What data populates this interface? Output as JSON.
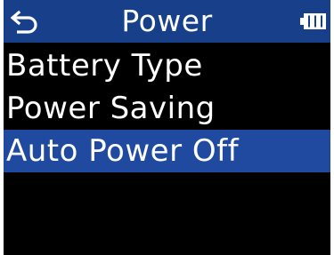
{
  "header": {
    "title": "Power",
    "back_icon": "back-return-icon",
    "battery_icon": "battery-icon"
  },
  "menu": {
    "items": [
      {
        "label": "Battery Type",
        "selected": false
      },
      {
        "label": "Power Saving",
        "selected": false
      },
      {
        "label": "Auto Power Off",
        "selected": true
      }
    ]
  },
  "colors": {
    "background": "#000000",
    "header_bg": "#173f8a",
    "selection_bg": "#1f4aa0",
    "text": "#ffffff"
  }
}
